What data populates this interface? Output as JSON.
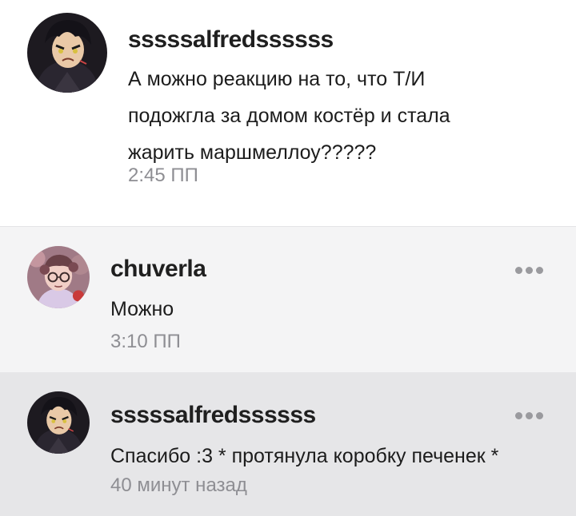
{
  "comments": [
    {
      "username": "sssssalfredssssss",
      "text_lines": [
        "А можно реакцию на то, что Т/И",
        "подожгла за домом костёр и стала",
        "жарить маршмеллоу?????"
      ],
      "time": "2:45 ПП",
      "avatar_icon": "dark-haired-character-avatar"
    },
    {
      "username": "chuverla",
      "text_lines": [
        "Можно"
      ],
      "time": "3:10 ПП",
      "avatar_icon": "pink-character-avatar",
      "more_icon": "more-options-icon"
    },
    {
      "username": "sssssalfredssssss",
      "text_lines": [
        "Спасибо :3 * протянула коробку печенек *"
      ],
      "time": "40 минут назад",
      "avatar_icon": "dark-haired-character-avatar",
      "more_icon": "more-options-icon"
    }
  ],
  "colors": {
    "reply_bg": "#f4f4f5",
    "highlight_bg": "#e6e6e8",
    "time_text": "#8e8e93"
  }
}
